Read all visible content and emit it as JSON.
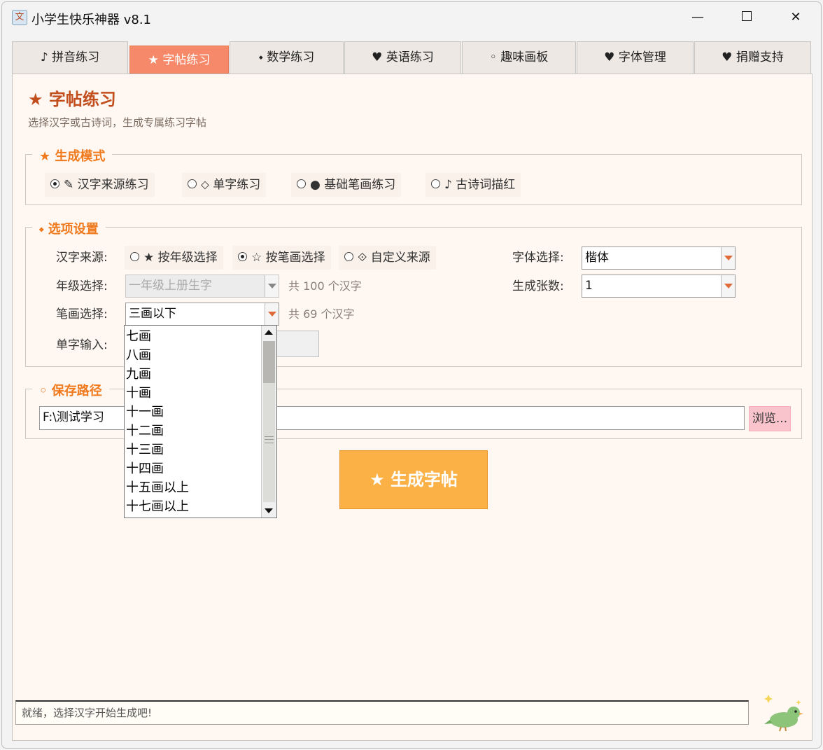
{
  "window": {
    "title": "小学生快乐神器 v8.1",
    "icon": "app-icon",
    "controls": {
      "minimize": "—",
      "maximize": "",
      "close": "✕"
    }
  },
  "tabs": [
    {
      "label": "♪ 拼音练习",
      "active": false
    },
    {
      "label": "★ 字帖练习",
      "active": true
    },
    {
      "label": "⬩ 数学练习",
      "active": false
    },
    {
      "label": "♥ 英语练习",
      "active": false
    },
    {
      "label": "◦ 趣味画板",
      "active": false
    },
    {
      "label": "♥ 字体管理",
      "active": false
    },
    {
      "label": "♥ 捐赠支持",
      "active": false
    }
  ],
  "page": {
    "title": "★ 字帖练习",
    "subtitle": "选择汉字或古诗词，生成专属练习字帖"
  },
  "mode_group": {
    "legend": "★ 生成模式",
    "options": [
      {
        "label": "✎ 汉字来源练习",
        "selected": true
      },
      {
        "label": "⬦ 单字练习",
        "selected": false
      },
      {
        "label": "● 基础笔画练习",
        "selected": false
      },
      {
        "label": "♪ 古诗词描红",
        "selected": false
      }
    ]
  },
  "options_group": {
    "legend": "⬩ 选项设置",
    "source_label": "汉字来源:",
    "source_options": [
      {
        "label": "★ 按年级选择",
        "selected": false
      },
      {
        "label": "☆ 按笔画选择",
        "selected": true
      },
      {
        "label": "⟐ 自定义来源",
        "selected": false
      }
    ],
    "grade_label": "年级选择:",
    "grade_value": "一年级上册生字",
    "grade_hint": "共 100 个汉字",
    "stroke_label": "笔画选择:",
    "stroke_value": "三画以下",
    "stroke_hint": "共 69 个汉字",
    "single_label": "单字输入:",
    "font_label": "字体选择:",
    "font_value": "楷体",
    "count_label": "生成张数:",
    "count_value": "1"
  },
  "save_group": {
    "legend": "◦ 保存路径",
    "path_value": "F:\\测试学习",
    "browse_label": "浏览..."
  },
  "generate_button": "★ 生成字帖",
  "status_text": "就绪，选择汉字开始生成吧!",
  "stroke_dropdown": {
    "items": [
      "七画",
      "八画",
      "九画",
      "十画",
      "十一画",
      "十二画",
      "十三画",
      "十四画",
      "十五画以上",
      "十七画以上"
    ]
  },
  "colors": {
    "accent_tab": "#f5896a",
    "title": "#c24e1e",
    "legend": "#f07a1e",
    "generate": "#fbb145",
    "browse": "#f9c4cc",
    "background": "#fff8f2"
  }
}
